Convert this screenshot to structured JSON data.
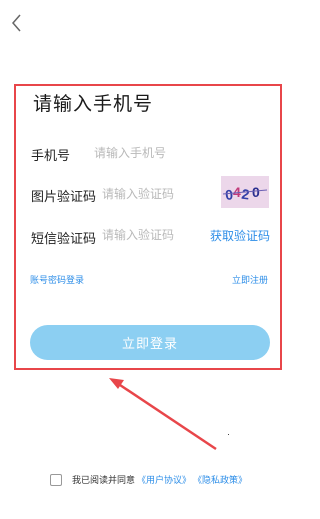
{
  "header": {
    "back_icon": "chevron-left-icon"
  },
  "form": {
    "title": "请输入手机号",
    "phone": {
      "label": "手机号",
      "placeholder": "请输入手机号"
    },
    "image_code": {
      "label": "图片验证码",
      "placeholder": "请输入验证码",
      "captcha_icon": "captcha-image"
    },
    "sms_code": {
      "label": "短信验证码",
      "placeholder": "请输入验证码",
      "get_code_label": "获取验证码"
    },
    "password_login_label": "账号密码登录",
    "register_label": "立即注册",
    "login_button_label": "立即登录"
  },
  "agreement": {
    "text": "我已阅读并同意",
    "user_agreement": "《用户协议》",
    "privacy_policy": "《隐私政策》"
  },
  "colors": {
    "accent": "#2d8ee8",
    "button": "#8ccff2",
    "highlight": "#e8464a"
  }
}
